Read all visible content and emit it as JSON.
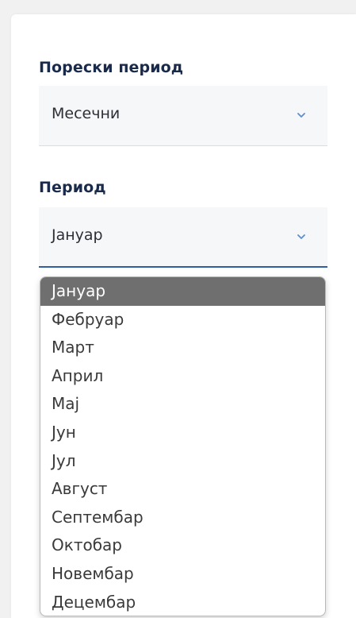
{
  "tax_period": {
    "label": "Порески период",
    "selected": "Месечни"
  },
  "period": {
    "label": "Период",
    "selected": "Јануар",
    "options": [
      "Јануар",
      "Фебруар",
      "Март",
      "Април",
      "Мај",
      "Јун",
      "Јул",
      "Август",
      "Септембар",
      "Октобар",
      "Новембар",
      "Децембар"
    ],
    "highlighted_index": 0
  },
  "icons": {
    "select_arrow": "chevron-down-icon"
  },
  "colors": {
    "label_text": "#1a2a4a",
    "focus_underline": "#2f5fa0",
    "highlight_bg": "#6f6f6f",
    "chevron": "#5b8fd0"
  }
}
